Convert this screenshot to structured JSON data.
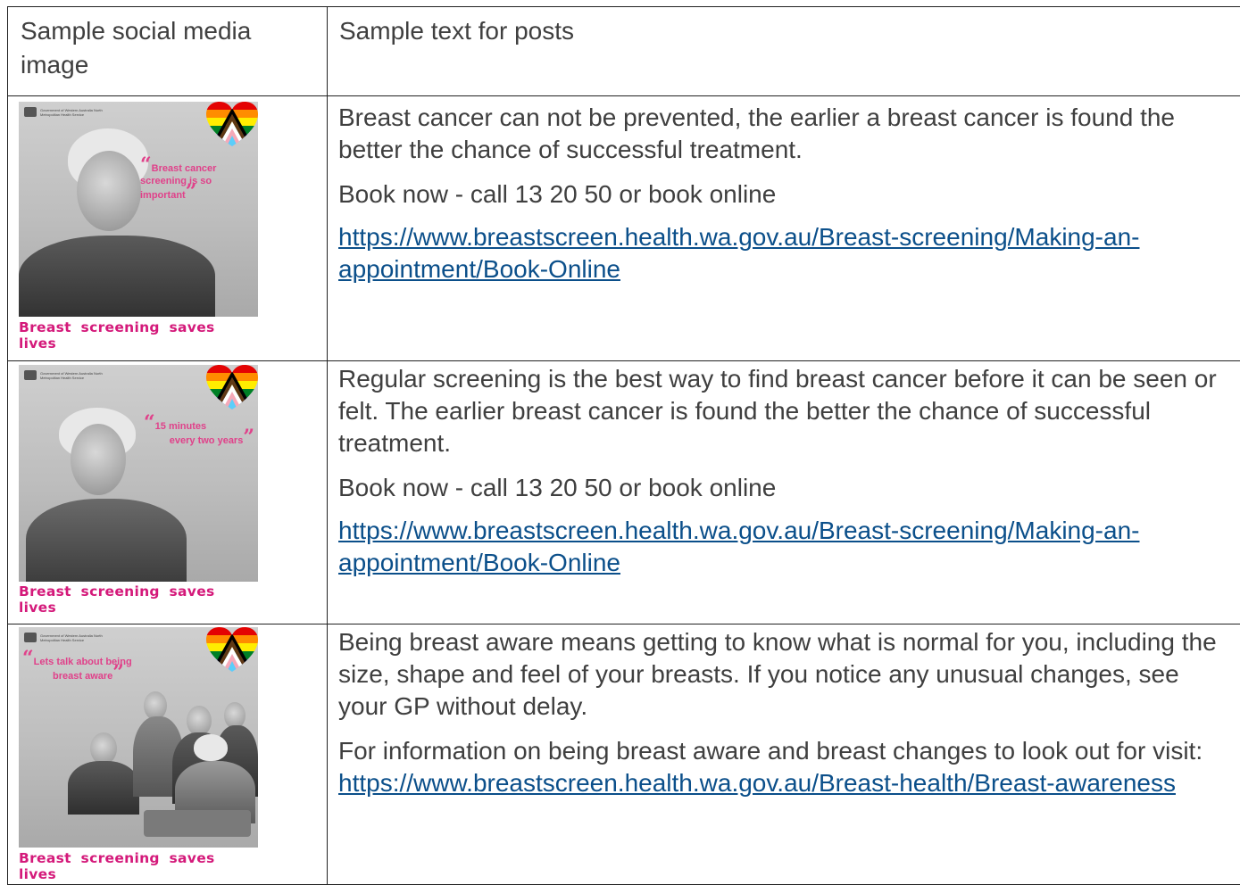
{
  "table": {
    "header": {
      "col1": "Sample social media image",
      "col2": "Sample text for posts"
    },
    "rows": [
      {
        "image": {
          "quote": "Breast cancer screening is so important",
          "tagline": "Breast  screening  saves  lives",
          "gov_text": "Government of Western Australia North Metropolitan Health Service"
        },
        "paragraph1": "Breast cancer can not be prevented, the earlier a breast cancer is found the better the chance of successful treatment.",
        "paragraph2": "Book now - call 13 20 50 or book online",
        "link": "https://www.breastscreen.health.wa.gov.au/Breast-screening/Making-an-appointment/Book-Online"
      },
      {
        "image": {
          "quote_line1": "15 minutes",
          "quote_line2": "every two years",
          "tagline": "Breast  screening  saves  lives",
          "gov_text": "Government of Western Australia North Metropolitan Health Service"
        },
        "paragraph1": "Regular screening is the best way to find breast cancer before it can be seen or felt. The earlier breast cancer is found the better the chance of successful treatment.",
        "paragraph2": "Book now - call 13 20 50 or book online",
        "link": "https://www.breastscreen.health.wa.gov.au/Breast-screening/Making-an-appointment/Book-Online"
      },
      {
        "image": {
          "quote_line1": "Lets talk about being",
          "quote_line2": "breast aware",
          "tagline": "Breast  screening  saves  lives",
          "gov_text": "Government of Western Australia North Metropolitan Health Service"
        },
        "paragraph1": "Being breast aware means getting to know what is normal for you, including the size, shape and feel of your breasts. If you notice any unusual changes, see your GP without delay.",
        "paragraph2_prefix": "For information on being breast aware and breast changes to look out for visit: ",
        "link": "https://www.breastscreen.health.wa.gov.au/Breast-health/Breast-awareness"
      }
    ]
  },
  "colors": {
    "link": "#0b4f8a",
    "tagline": "#d4197a",
    "quote": "#e0418a",
    "text": "#3f3f3f"
  }
}
